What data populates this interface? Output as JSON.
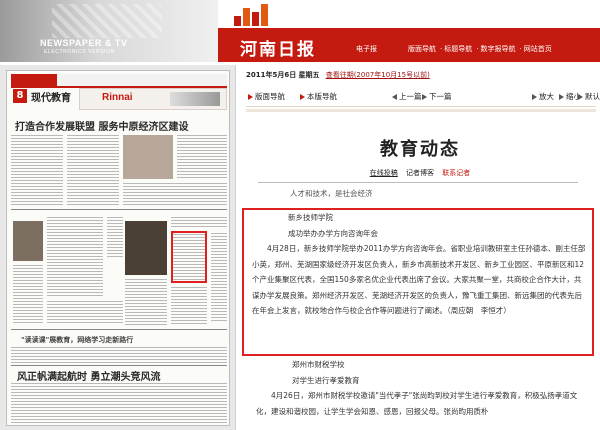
{
  "banner": {
    "newspaper_title": "NEWSPAPER & TV",
    "newspaper_sub": "ELECTRONICS VERSION",
    "brand_name": "河南日报",
    "brand_tag": "电子报",
    "nav": [
      "版面导航",
      "标题导航",
      "数字报导航",
      "网站首页"
    ],
    "nav_separator": "·",
    "accent": "#c41a10"
  },
  "thumbnail": {
    "page_number": "8",
    "section": "现代教育",
    "ad_brand": "Rinnai",
    "headline": "打造合作发展联盟  服务中原经济区建设",
    "sub_headline": "\"读读课\"展教育，网络学习走新路行",
    "bottom_headline": "风正帆满起航时  勇立潮头竞风流"
  },
  "toolbar": {
    "date": "2011年5月6日",
    "weekday": "星期五",
    "history_link": "查看往期(2007年10月15号以前)",
    "page_nav": "版面导航",
    "this_page_nav": "本版导航",
    "prev": "上一篇",
    "next": "下一篇",
    "zoom_in": "放大",
    "zoom_out": "缩小",
    "default": "默认"
  },
  "article": {
    "title": "教育动态",
    "meta_online": "在线投稿",
    "meta_blog": "记者博客",
    "meta_contact": "联系记者",
    "cut_top": "人才和技术，是社会经济",
    "block1_heading": "新乡技师学院",
    "block1_sub": "成功举办办学方向咨询年会",
    "block1_text": "4月28日，新乡技师学院举办2011办学方向咨询年会。省职业培训教研室主任孙德本、副主任部小英，郑州、芜湖国家级经济开发区负责人，新乡市高新技术开发区、新乡工业园区、平原新区和12个产业集聚区代表，全国150多家名优企业代表出席了会议。大家共聚一堂，共商校企合作大计，共谋办学发展良策。郑州经济开发区、芜湖经济开发区的负责人，豫飞重工集团、新远集团的代表先后在年会上发言，就校地合作与校企合作等问题进行了阐述。（周应朝　李恒才）",
    "block2_heading": "郑州市财税学校",
    "block2_sub": "对学生进行孝爱教育",
    "block2_text": "4月26日，郑州市财税学校邀请\"当代孝子\"张尚昀到校对学生进行孝爱教育，积极弘扬孝道文化，建设和谐校园，让学生学会知恩、感恩，回报父母。张尚昀用质朴"
  }
}
